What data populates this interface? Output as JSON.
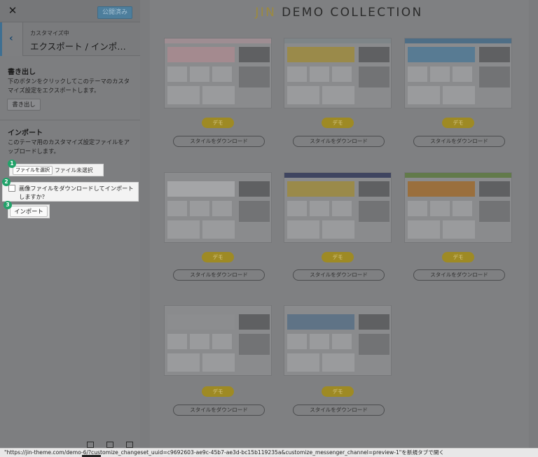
{
  "toolbar": {
    "close_glyph": "✕",
    "publish_label": "公開済み"
  },
  "section": {
    "crumb": "カスタマイズ中",
    "title": "エクスポート / インポ…",
    "back_glyph": "‹"
  },
  "export": {
    "heading": "書き出し",
    "description": "下のボタンをクリックしてこのテーマのカスタマイズ設定をエクスポートします。",
    "button_label": "書き出し"
  },
  "import": {
    "heading": "インポート",
    "description": "このテーマ用のカスタマイズ設定ファイルをアップロードします。",
    "file_button": "ファイルを選択",
    "file_status": "ファイル未選択",
    "checkbox_label": "画像ファイルをダウンロードしてインポートしますか？",
    "checkbox_checked": false,
    "import_button": "インポート",
    "steps": [
      "1",
      "2",
      "3"
    ]
  },
  "preview": {
    "brand_jin": "JIN",
    "brand_rest": " DEMO COLLECTION",
    "demo_label": "デモ",
    "download_label": "スタイルをダウンロード",
    "cards": [
      {
        "header_color": "#9e8d92",
        "accent": "#a48a8f"
      },
      {
        "header_color": "#7e8588",
        "accent": "#9a8a4a"
      },
      {
        "header_color": "#4e6e86",
        "accent": "#587b93"
      },
      {
        "header_color": "#8a8b8d",
        "accent": "#a4a5a7"
      },
      {
        "header_color": "#3f4560",
        "accent": "#9a8a4a"
      },
      {
        "header_color": "#627a4a",
        "accent": "#9a6f3d"
      },
      {
        "header_color": "#8a8b8d",
        "accent": "#8c8d8f"
      },
      {
        "header_color": "#8a8b8d",
        "accent": "#5f7386"
      }
    ]
  },
  "status_url": "\"https://jin-theme.com/demo-6/?customize_changeset_uuid=c9692603-ae9c-45b7-ae3d-bc15b119235a&customize_messenger_channel=preview-1\"を新規タブで開く",
  "colors": {
    "step_green": "#21a36a",
    "publish_blue": "#4d7e9c",
    "demo_gold": "#9e8a24"
  },
  "icons": [
    "close-icon",
    "chevron-left-icon",
    "monitor-icon",
    "download-circle-icon"
  ]
}
